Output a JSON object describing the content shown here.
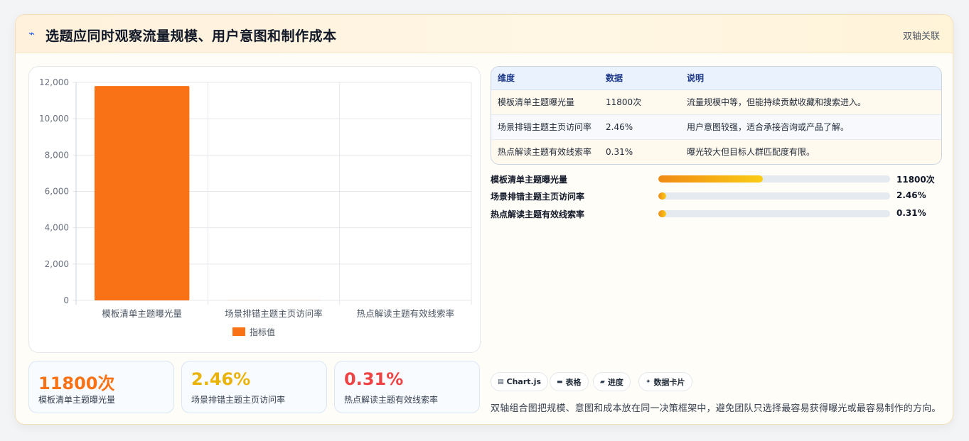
{
  "header": {
    "icon": "bolt-icon",
    "title": "选题应同时观察流量规模、用户意图和制作成本",
    "tag": "双轴关联"
  },
  "chart_data": {
    "type": "bar",
    "categories": [
      "模板清单主题曝光量",
      "场景排错主题主页访问率",
      "热点解读主题有效线索率"
    ],
    "series": [
      {
        "name": "指标值",
        "values": [
          11800,
          2.46,
          0.31
        ],
        "color": "#f97316"
      }
    ],
    "ylim": [
      0,
      12000
    ],
    "yticks": [
      "0",
      "2,000",
      "4,000",
      "6,000",
      "8,000",
      "10,000",
      "12,000"
    ],
    "ytick_values": [
      0,
      2000,
      4000,
      6000,
      8000,
      10000,
      12000
    ],
    "grid": true,
    "legend_position": "bottom"
  },
  "stats": [
    {
      "value": "11800次",
      "label": "模板清单主题曝光量",
      "color": "#f97316"
    },
    {
      "value": "2.46%",
      "label": "场景排错主题主页访问率",
      "color": "#eab308"
    },
    {
      "value": "0.31%",
      "label": "热点解读主题有效线索率",
      "color": "#ef4444"
    }
  ],
  "table": {
    "headers": [
      "维度",
      "数据",
      "说明"
    ],
    "rows": [
      [
        "模板清单主题曝光量",
        "11800次",
        "流量规模中等，但能持续贡献收藏和搜索进入。"
      ],
      [
        "场景排错主题主页访问率",
        "2.46%",
        "用户意图较强，适合承接咨询或产品了解。"
      ],
      [
        "热点解读主题有效线索率",
        "0.31%",
        "曝光较大但目标人群匹配度有限。"
      ]
    ]
  },
  "progress": [
    {
      "label": "模板清单主题曝光量",
      "value_text": "11800次",
      "fraction": 0.45
    },
    {
      "label": "场景排错主题主页访问率",
      "value_text": "2.46%",
      "fraction": 0.0246
    },
    {
      "label": "热点解读主题有效线索率",
      "value_text": "0.31%",
      "fraction": 0.0031
    }
  ],
  "chips": [
    {
      "icon": "chart-icon",
      "glyph": "▤",
      "label": "Chart.js"
    },
    {
      "icon": "table-icon",
      "glyph": "▬",
      "label": "表格"
    },
    {
      "icon": "progress-icon",
      "glyph": "▰",
      "label": "进度"
    },
    {
      "icon": "card-icon",
      "glyph": "✦",
      "label": "数据卡片"
    }
  ],
  "note": "双轴组合图把规模、意图和成本放在同一决策框架中，避免团队只选择最容易获得曝光或最容易制作的方向。"
}
